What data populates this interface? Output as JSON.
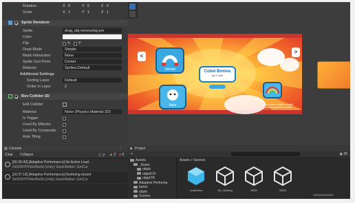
{
  "inspector": {
    "rotation": {
      "label": "Rotation",
      "x": "X",
      "xv": "0",
      "y": "Y",
      "yv": "0",
      "z": "Z",
      "zv": "0"
    },
    "scale": {
      "label": "Scale",
      "x": "X",
      "xv": "1",
      "y": "Y",
      "yv": "1",
      "z": "Z",
      "zv": "1"
    },
    "sprite_renderer": {
      "title": "Sprite Renderer",
      "sprite_label": "Sprite",
      "sprite_value": "drag_obj-removebg-pre",
      "color_label": "Color",
      "flip_label": "Flip",
      "flip_x": "X",
      "flip_y": "Y",
      "draw_mode_label": "Draw Mode",
      "draw_mode_value": "Simple",
      "mask_label": "Mask Interaction",
      "mask_value": "None",
      "sort_point_label": "Sprite Sort Point",
      "sort_point_value": "Center",
      "material_label": "Material",
      "material_value": "Sprites-Default",
      "additional": "Additional Settings",
      "sorting_layer_label": "Sorting Layer",
      "sorting_layer_value": "Default",
      "order_label": "Order in Layer",
      "order_value": "2"
    },
    "box_collider": {
      "title": "Box Collider 2D",
      "edit_label": "Edit Collider",
      "material_label": "Material",
      "material_value": "None (Physics Material 2D)",
      "trigger_label": "Is Trigger",
      "effector_label": "Used By Effector",
      "composite_label": "Used By Composite",
      "tiling_label": "Auto Tiling"
    }
  },
  "console": {
    "tab": "Console",
    "clear": "Clear",
    "collapse": "Collapse",
    "count_log": "2",
    "count_warn": "0",
    "count_error": "0",
    "logs": [
      {
        "line1": "[06:36:40] [Adaptive Performance] No Active Load",
        "line2": "0x00007ff7b6ef9a0d (Unity) StackWalker::GetCur"
      },
      {
        "line1": "[16:37:18] [Adaptive Performance] Restoring durant",
        "line2": "0x00007ff7b6ef9a0d (Unity) StackWalker::GetCur"
      }
    ]
  },
  "game": {
    "card_left_top": "Jalmpil",
    "card_left_bottom": "bubs",
    "title": "Cobel Bomeu",
    "subtitle": "tap to start",
    "note": "Tap number of bobs to vanish bobs are parameter to picks",
    "prev": "<",
    "next": ">"
  },
  "project": {
    "tab": "Project",
    "add": "+",
    "count": "25",
    "tree": [
      {
        "label": "Assets",
        "depth": 0
      },
      {
        "label": "_Asset",
        "depth": 1
      },
      {
        "label": "objek",
        "depth": 2
      },
      {
        "label": "objekCH",
        "depth": 2
      },
      {
        "label": "objekTK",
        "depth": 2
      },
      {
        "label": "Adaptive Performa",
        "depth": 1
      },
      {
        "label": "bnner",
        "depth": 1
      },
      {
        "label": "objek",
        "depth": 1
      },
      {
        "label": "Scenes",
        "depth": 1
      }
    ],
    "breadcrumb": "Assets > Scenes",
    "assets": [
      "AudioMan",
      "08_Ukelang",
      "OB31",
      "OB32"
    ]
  },
  "colors": {
    "unity_dark": "#3a3a3a",
    "game_orange": "#ffb43a",
    "game_red": "#e2392b",
    "card_blue": "#3aa7e0",
    "panel_gray": "#242424"
  },
  "icons": [
    "move-tool-icon",
    "hand-tool-icon",
    "sprite-renderer-icon",
    "box-collider-icon",
    "info-icon",
    "folder-icon",
    "unity-scene-icon",
    "audio-manager-icon"
  ]
}
